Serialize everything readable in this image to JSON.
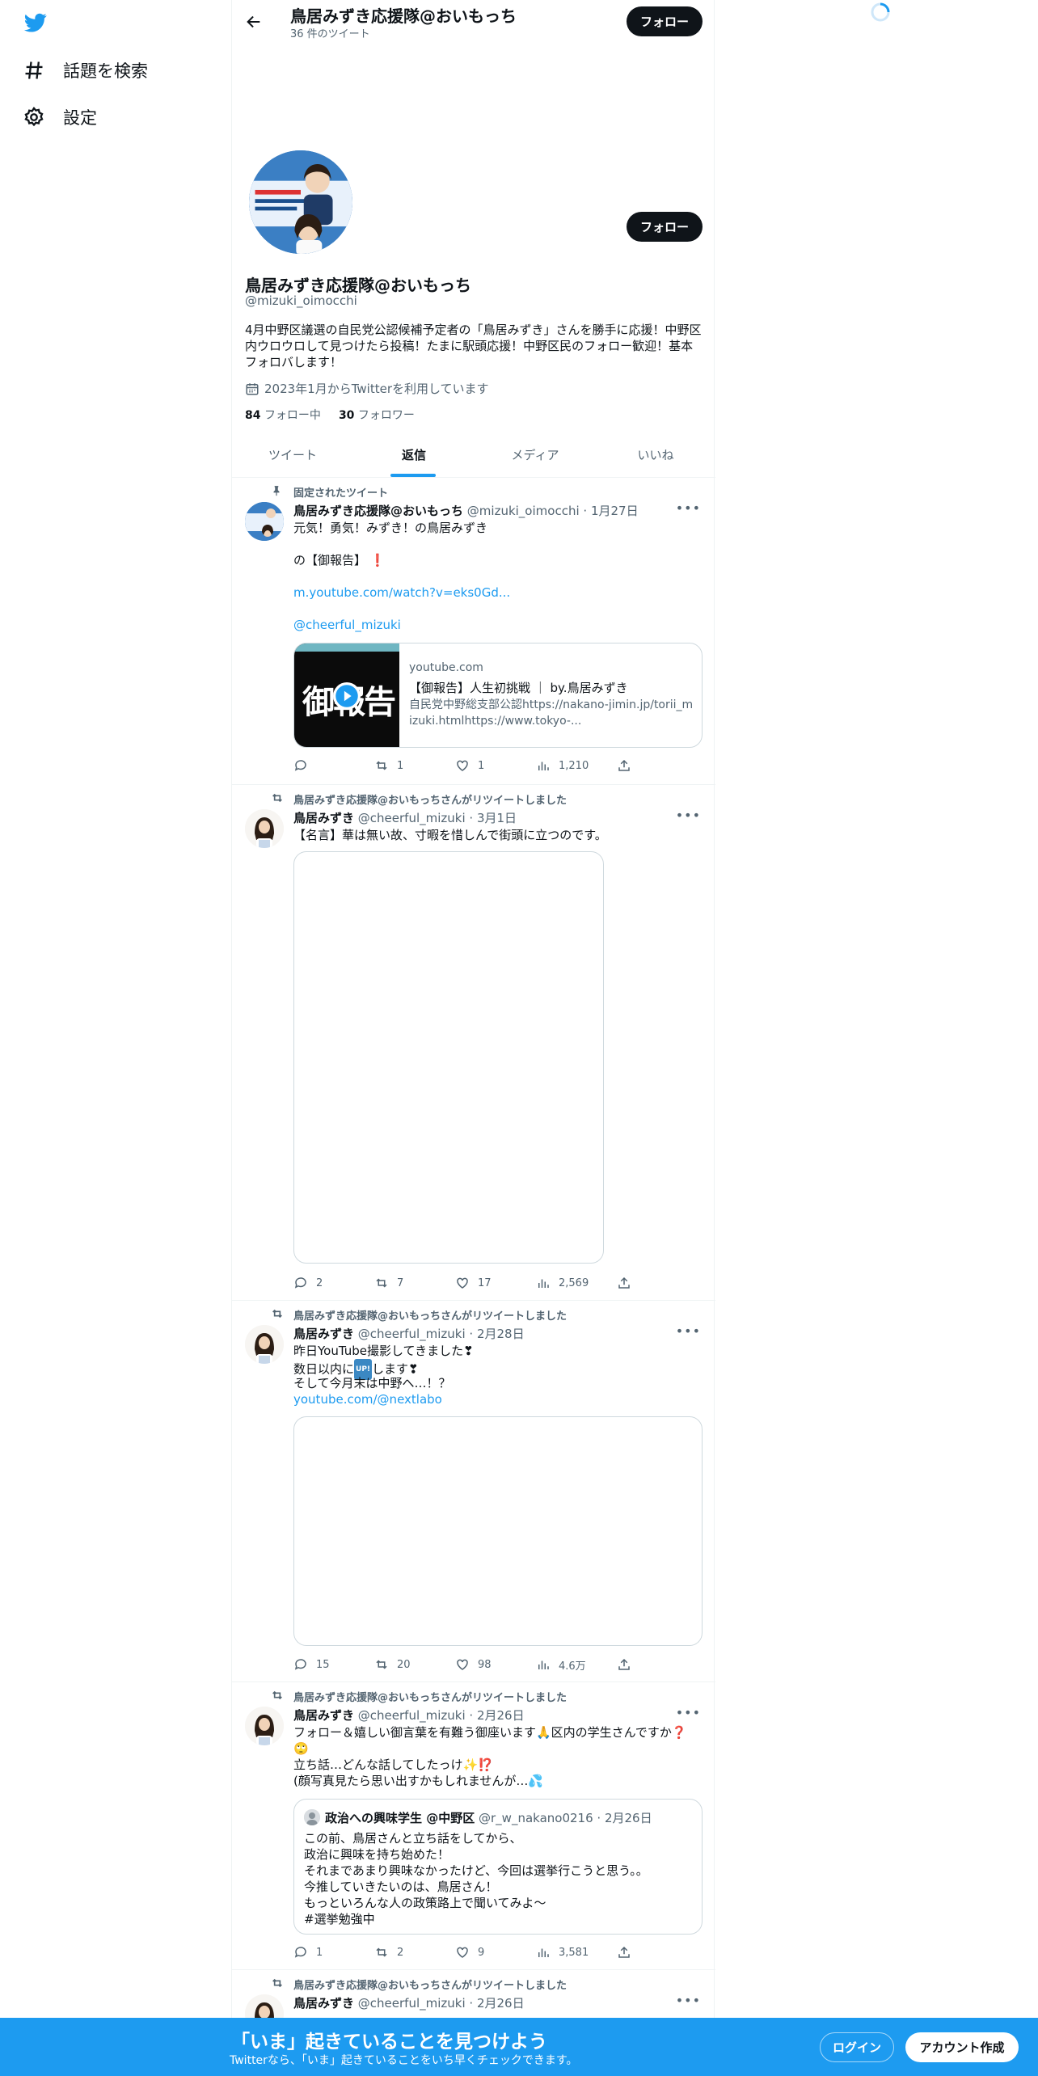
{
  "nav": {
    "explore_label": "話題を検索",
    "settings_label": "設定"
  },
  "header": {
    "title": "鳥居みずき応援隊@おいもっち",
    "tweet_count": "36 件のツイート",
    "follow_label": "フォロー"
  },
  "profile": {
    "display_name": "鳥居みずき応援隊@おいもっち",
    "handle": "@mizuki_oimocchi",
    "bio": "4月中野区議選の自民党公認候補予定者の「鳥居みずき」さんを勝手に応援！中野区内ウロウロして見つけたら投稿！たまに駅頭応援！中野区民のフォロー歓迎！基本フォロバします！",
    "joined": "2023年1月からTwitterを利用しています",
    "following_count": "84",
    "following_label": "フォロー中",
    "followers_count": "30",
    "followers_label": "フォロワー",
    "follow_label": "フォロー"
  },
  "tabs": [
    {
      "label": "ツイート"
    },
    {
      "label": "返信"
    },
    {
      "label": "メディア"
    },
    {
      "label": "いいね"
    }
  ],
  "tweets": [
    {
      "context": "固定されたツイート",
      "name": "鳥居みずき応援隊@おいもっち",
      "handle": "@mizuki_oimocchi",
      "date": "1月27日",
      "line1": "元気！勇気！みずき！の鳥居みずき",
      "line2": "の【御報告】",
      "emoji": "❗",
      "link1": "m.youtube.com/watch?v=eks0Gd...",
      "link2": "@cheerful_mizuki",
      "card": {
        "thumb_text": "御報告",
        "domain": "youtube.com",
        "title": "【御報告】人生初挑戦 ｜ by.鳥居みずき",
        "desc": "自民党中野総支部公認https://nakano-jimin.jp/torii_mizuki.htmlhttps://www.tokyo-..."
      },
      "replies": "",
      "retweets": "1",
      "likes": "1",
      "views": "1,210"
    },
    {
      "context": "鳥居みずき応援隊@おいもっちさんがリツイートしました",
      "name": "鳥居みずき",
      "handle": "@cheerful_mizuki",
      "date": "3月1日",
      "line1": "【名言】華は無い故、寸暇を惜しんで街頭に立つのです。",
      "replies": "2",
      "retweets": "7",
      "likes": "17",
      "views": "2,569"
    },
    {
      "context": "鳥居みずき応援隊@おいもっちさんがリツイートしました",
      "name": "鳥居みずき",
      "handle": "@cheerful_mizuki",
      "date": "2月28日",
      "line1": "昨日YouTube撮影してきました❣",
      "line2a": "数日以内に",
      "up_badge": "UP!",
      "line2b": "します❣",
      "line3": "そして今月末は中野へ…！？",
      "link1": "youtube.com/@nextlabo",
      "replies": "15",
      "retweets": "20",
      "likes": "98",
      "views": "4.6万"
    },
    {
      "context": "鳥居みずき応援隊@おいもっちさんがリツイートしました",
      "name": "鳥居みずき",
      "handle": "@cheerful_mizuki",
      "date": "2月26日",
      "line1": "フォロー＆嬉しい御言葉を有難う御座います🙏区内の学生さんですか❓",
      "line2": "🙄",
      "line3": "立ち話…どんな話してしたっけ✨⁉️",
      "line4": "(顔写真見たら思い出すかもしれませんが…💦",
      "quote": {
        "name": "政治への興味学生 @中野区",
        "handle": "@r_w_nakano0216",
        "date": "2月26日",
        "lines": [
          "この前、鳥居さんと立ち話をしてから、",
          "政治に興味を持ち始めた！",
          "それまであまり興味なかったけど、今回は選挙行こうと思う。。",
          "今推していきたいのは、鳥居さん！",
          "もっといろんな人の政策路上で聞いてみよ〜",
          "#選挙勉強中"
        ]
      },
      "replies": "1",
      "retweets": "2",
      "likes": "9",
      "views": "3,581"
    },
    {
      "context": "鳥居みずき応援隊@おいもっちさんがリツイートしました",
      "name": "鳥居みずき",
      "handle": "@cheerful_mizuki",
      "date": "2月26日"
    }
  ],
  "bottom_bar": {
    "headline": "「いま」起きていることを見つけよう",
    "sub": "Twitterなら、「いま」起きていることをいち早くチェックできます。",
    "login_label": "ログイン",
    "signup_label": "アカウント作成"
  },
  "colors": {
    "accent": "#1d9bf0",
    "text": "#0f1419",
    "secondary": "#536471",
    "like_red": "#f91880"
  },
  "icons": {
    "logo": "twitter-bird-icon",
    "explore": "hashtag-icon",
    "settings": "gear-icon",
    "back": "arrow-left-icon",
    "loading": "spinner-icon"
  }
}
